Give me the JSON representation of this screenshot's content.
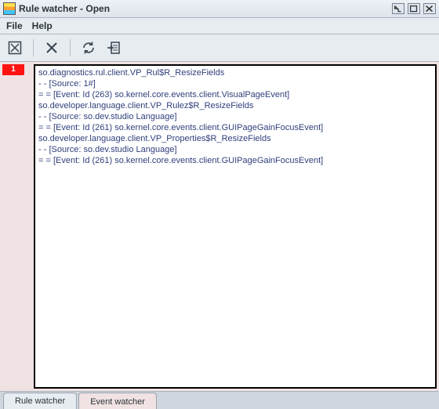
{
  "window": {
    "title": "Rule watcher - Open"
  },
  "menu": {
    "file": "File",
    "help": "Help"
  },
  "gutter": {
    "tag": "1"
  },
  "log": {
    "lines": [
      "so.diagnostics.rul.client.VP_Rul$R_ResizeFields",
      "- - [Source: 1#]",
      "= = [Event: Id (263) so.kernel.core.events.client.VisualPageEvent]",
      "so.developer.language.client.VP_Rulez$R_ResizeFields",
      "- - [Source: so.dev.studio Language]",
      "= = [Event: Id (261) so.kernel.core.events.client.GUIPageGainFocusEvent]",
      "so.developer.language.client.VP_Properties$R_ResizeFields",
      "- - [Source: so.dev.studio Language]",
      "= = [Event: Id (261) so.kernel.core.events.client.GUIPageGainFocusEvent]"
    ]
  },
  "tabs": {
    "rule": "Rule watcher",
    "event": "Event watcher"
  }
}
